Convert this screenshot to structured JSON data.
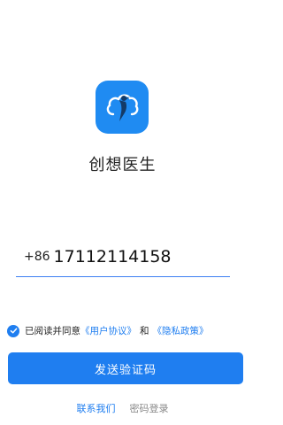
{
  "app": {
    "name": "创想医生",
    "brand_color": "#1f8bf2",
    "logo_icon": "bird-on-rounded-cloud-logo"
  },
  "login": {
    "country_code": "+86",
    "phone_value": "17112114158"
  },
  "agreement": {
    "checked": true,
    "prefix": "已阅读并同意",
    "user_agreement": "《用户协议》",
    "conj": "和",
    "privacy_policy": "《隐私政策》"
  },
  "actions": {
    "send_code": "发送验证码",
    "contact_us": "联系我们",
    "password_login": "密码登录"
  }
}
